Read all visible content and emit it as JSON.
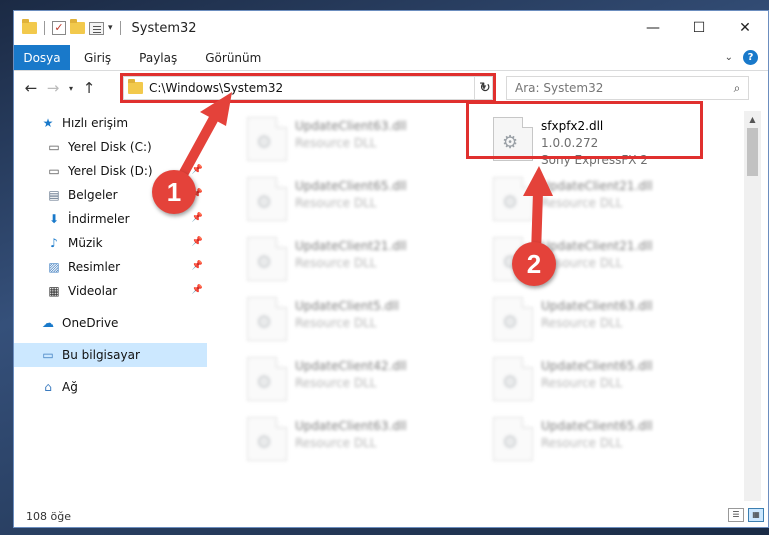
{
  "window": {
    "title": "System32",
    "controls": {
      "minimize": "—",
      "maximize": "☐",
      "close": "✕"
    }
  },
  "ribbon": {
    "tabs": [
      "Dosya",
      "Giriş",
      "Paylaş",
      "Görünüm"
    ],
    "help": "?"
  },
  "navigation": {
    "back": "←",
    "forward": "→",
    "recent": "▾",
    "up": "↑",
    "address": "C:\\Windows\\System32",
    "refresh": "↻",
    "search_placeholder": "Ara: System32"
  },
  "sidebar": {
    "items": [
      {
        "label": "Hızlı erişim",
        "icon": "star-icon",
        "glyph": "★",
        "color": "#1979ca"
      },
      {
        "label": "Yerel Disk (C:)",
        "icon": "drive-icon",
        "glyph": "▭",
        "color": "#555555",
        "pinned": false
      },
      {
        "label": "Yerel Disk (D:)",
        "icon": "drive-icon",
        "glyph": "▭",
        "color": "#555555",
        "pinned": true
      },
      {
        "label": "Belgeler",
        "icon": "documents-icon",
        "glyph": "▤",
        "color": "#5b6e85",
        "pinned": true
      },
      {
        "label": "İndirmeler",
        "icon": "download-icon",
        "glyph": "⬇",
        "color": "#1979ca",
        "pinned": true
      },
      {
        "label": "Müzik",
        "icon": "music-icon",
        "glyph": "♪",
        "color": "#1979ca",
        "pinned": true
      },
      {
        "label": "Resimler",
        "icon": "pictures-icon",
        "glyph": "▨",
        "color": "#3b7bbf",
        "pinned": true
      },
      {
        "label": "Videolar",
        "icon": "videos-icon",
        "glyph": "▦",
        "color": "#333333",
        "pinned": true
      }
    ],
    "onedrive": {
      "label": "OneDrive",
      "glyph": "☁",
      "color": "#1979ca"
    },
    "thispc": {
      "label": "Bu bilgisayar",
      "glyph": "▭",
      "color": "#3b7bbf"
    },
    "network": {
      "label": "Ağ",
      "glyph": "⌂",
      "color": "#3b7bbf"
    },
    "pin_glyph": "📌"
  },
  "files": {
    "target": {
      "name": "sfxpfx2.dll",
      "version": "1.0.0.272",
      "desc": "Sony ExpressFX 2"
    },
    "left_column": [
      {
        "name": "UpdateClient63.dll",
        "desc": "Resource DLL"
      },
      {
        "name": "UpdateClient65.dll",
        "desc": "Resource DLL"
      },
      {
        "name": "UpdateClient21.dll",
        "desc": "Resource DLL"
      },
      {
        "name": "UpdateClient5.dll",
        "desc": "Resource DLL"
      },
      {
        "name": "UpdateClient42.dll",
        "desc": "Resource DLL"
      },
      {
        "name": "UpdateClient63.dll",
        "desc": "Resource DLL"
      }
    ],
    "right_column": [
      {
        "name": "UpdateClient21.dll",
        "desc": "Resource DLL"
      },
      {
        "name": "UpdateClient21.dll",
        "desc": "Resource DLL"
      },
      {
        "name": "UpdateClient63.dll",
        "desc": "Resource DLL"
      },
      {
        "name": "UpdateClient65.dll",
        "desc": "Resource DLL"
      },
      {
        "name": "UpdateClient65.dll",
        "desc": "Resource DLL"
      }
    ]
  },
  "status": {
    "count": "108 öğe"
  },
  "annotations": {
    "badge1": "1",
    "badge2": "2",
    "color": "#e4423a"
  }
}
